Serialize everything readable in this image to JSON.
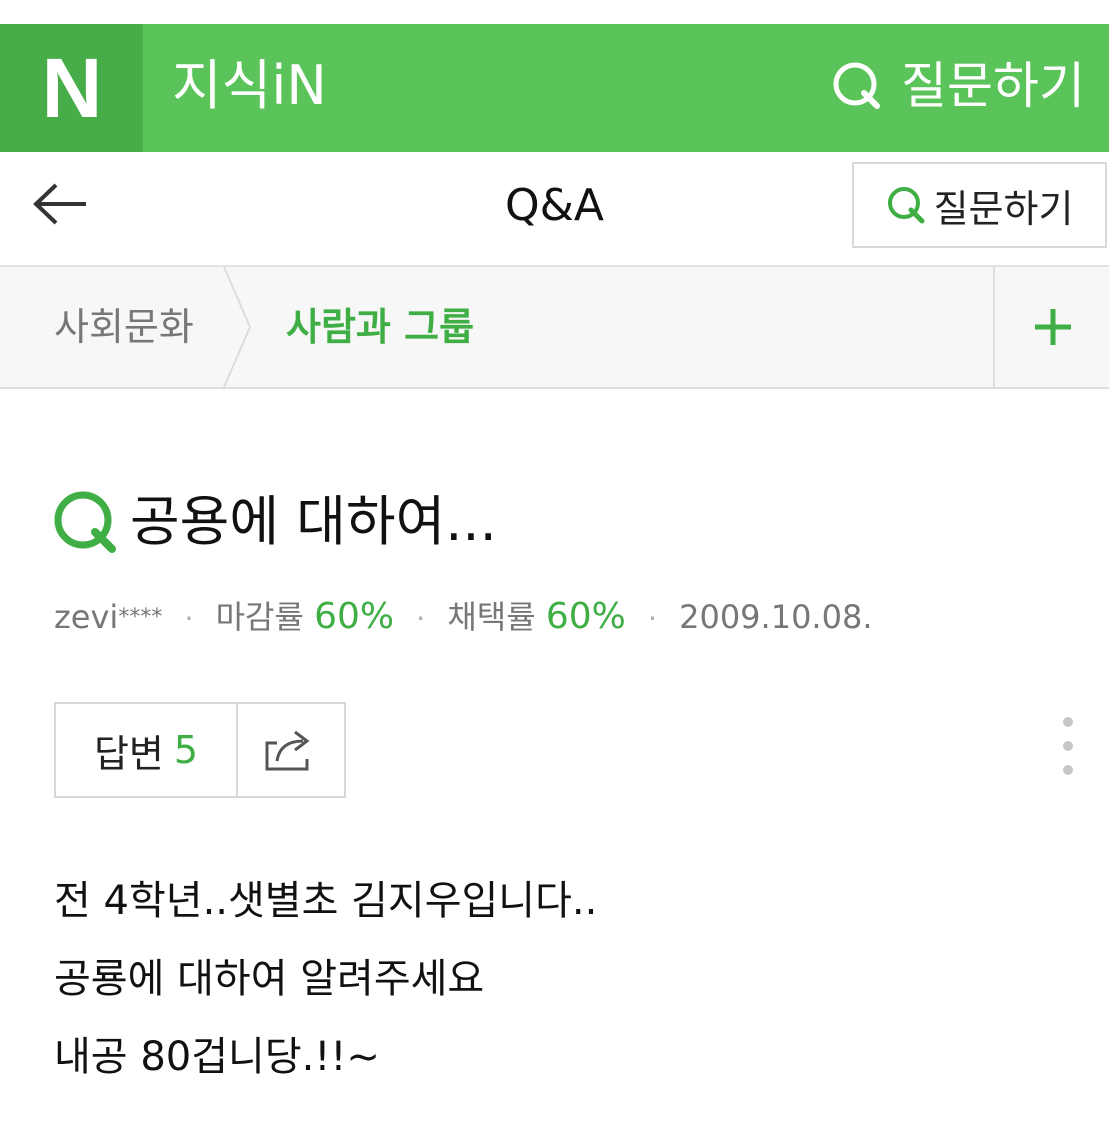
{
  "app": {
    "logo_letter": "N",
    "service_name": "지식iN",
    "ask_label": "질문하기",
    "brand_green": "#5ac359",
    "logo_green": "#46ad48",
    "accent_green": "#3fae45"
  },
  "subheader": {
    "back_icon": "left-arrow-icon",
    "title": "Q&A",
    "ask_label": "질문하기"
  },
  "breadcrumb": {
    "items": [
      "사회문화",
      "사람과 그룹"
    ],
    "add_icon": "plus-icon"
  },
  "question": {
    "title": "공용에 대하여...",
    "author": "zevi",
    "author_mask": "****",
    "close_rate_label": "마감률",
    "close_rate": "60%",
    "adopt_rate_label": "채택률",
    "adopt_rate": "60%",
    "date": "2009.10.08."
  },
  "actions": {
    "answers_label": "답변",
    "answers_count": "5",
    "share_icon": "share-icon",
    "more_icon": "more-vertical-icon"
  },
  "body": {
    "lines": [
      "전 4학년..샛별초 김지우입니다..",
      "공룡에 대하여 알려주세요",
      "내공 80겁니당.!!~"
    ]
  }
}
